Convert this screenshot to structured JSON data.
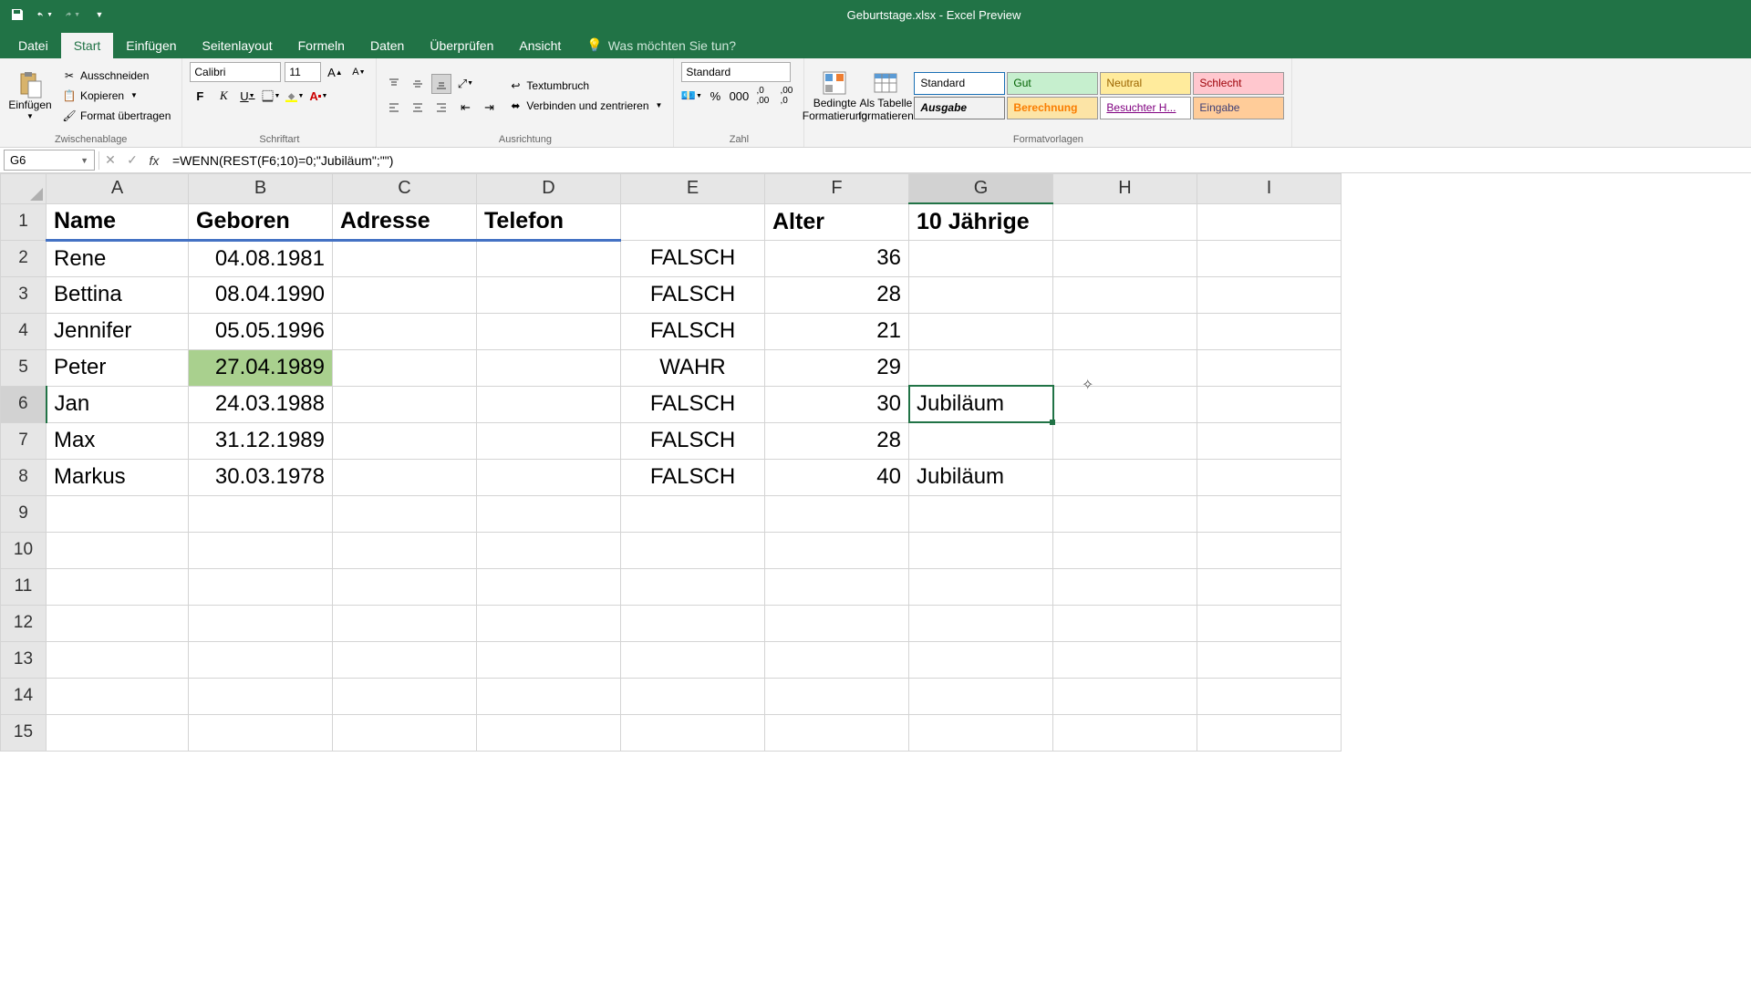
{
  "title": "Geburtstage.xlsx - Excel Preview",
  "tabs": {
    "datei": "Datei",
    "start": "Start",
    "einfuegen": "Einfügen",
    "seitenlayout": "Seitenlayout",
    "formeln": "Formeln",
    "daten": "Daten",
    "ueberpruefen": "Überprüfen",
    "ansicht": "Ansicht",
    "tellme_placeholder": "Was möchten Sie tun?"
  },
  "ribbon": {
    "einfuegen_btn": "Einfügen",
    "ausschneiden": "Ausschneiden",
    "kopieren": "Kopieren",
    "format_uebertragen": "Format übertragen",
    "zwischenablage": "Zwischenablage",
    "font_name": "Calibri",
    "font_size": "11",
    "schriftart": "Schriftart",
    "textumbruch": "Textumbruch",
    "verbinden": "Verbinden und zentrieren",
    "ausrichtung": "Ausrichtung",
    "number_format": "Standard",
    "zahl": "Zahl",
    "bedingte_formatierung": "Bedingte\nFormatierung",
    "als_tabelle": "Als Tabelle\nformatieren",
    "style_standard": "Standard",
    "style_gut": "Gut",
    "style_neutral": "Neutral",
    "style_schlecht": "Schlecht",
    "style_ausgabe": "Ausgabe",
    "style_berechnung": "Berechnung",
    "style_besuchter": "Besuchter H...",
    "style_eingabe": "Eingabe",
    "formatvorlagen": "Formatvorlagen"
  },
  "formula_bar": {
    "name_box": "G6",
    "formula": "=WENN(REST(F6;10)=0;\"Jubiläum\";\"\")"
  },
  "columns": [
    "A",
    "B",
    "C",
    "D",
    "E",
    "F",
    "G",
    "H",
    "I"
  ],
  "selected_col": "G",
  "selected_row": "6",
  "headers": {
    "A": "Name",
    "B": "Geboren",
    "C": "Adresse",
    "D": "Telefon",
    "E": "",
    "F": "Alter",
    "G": "10 Jährige",
    "H": "",
    "I": ""
  },
  "rows": [
    {
      "r": "2",
      "A": "Rene",
      "B": "04.08.1981",
      "E": "FALSCH",
      "F": "36",
      "G": ""
    },
    {
      "r": "3",
      "A": "Bettina",
      "B": "08.04.1990",
      "E": "FALSCH",
      "F": "28",
      "G": ""
    },
    {
      "r": "4",
      "A": "Jennifer",
      "B": "05.05.1996",
      "E": "FALSCH",
      "F": "21",
      "G": ""
    },
    {
      "r": "5",
      "A": "Peter",
      "B": "27.04.1989",
      "E": "WAHR",
      "F": "29",
      "G": ""
    },
    {
      "r": "6",
      "A": "Jan",
      "B": "24.03.1988",
      "E": "FALSCH",
      "F": "30",
      "G": "Jubiläum"
    },
    {
      "r": "7",
      "A": "Max",
      "B": "31.12.1989",
      "E": "FALSCH",
      "F": "28",
      "G": ""
    },
    {
      "r": "8",
      "A": "Markus",
      "B": "30.03.1978",
      "E": "FALSCH",
      "F": "40",
      "G": "Jubiläum"
    }
  ],
  "empty_rows": [
    "9",
    "10",
    "11",
    "12",
    "13",
    "14",
    "15"
  ]
}
